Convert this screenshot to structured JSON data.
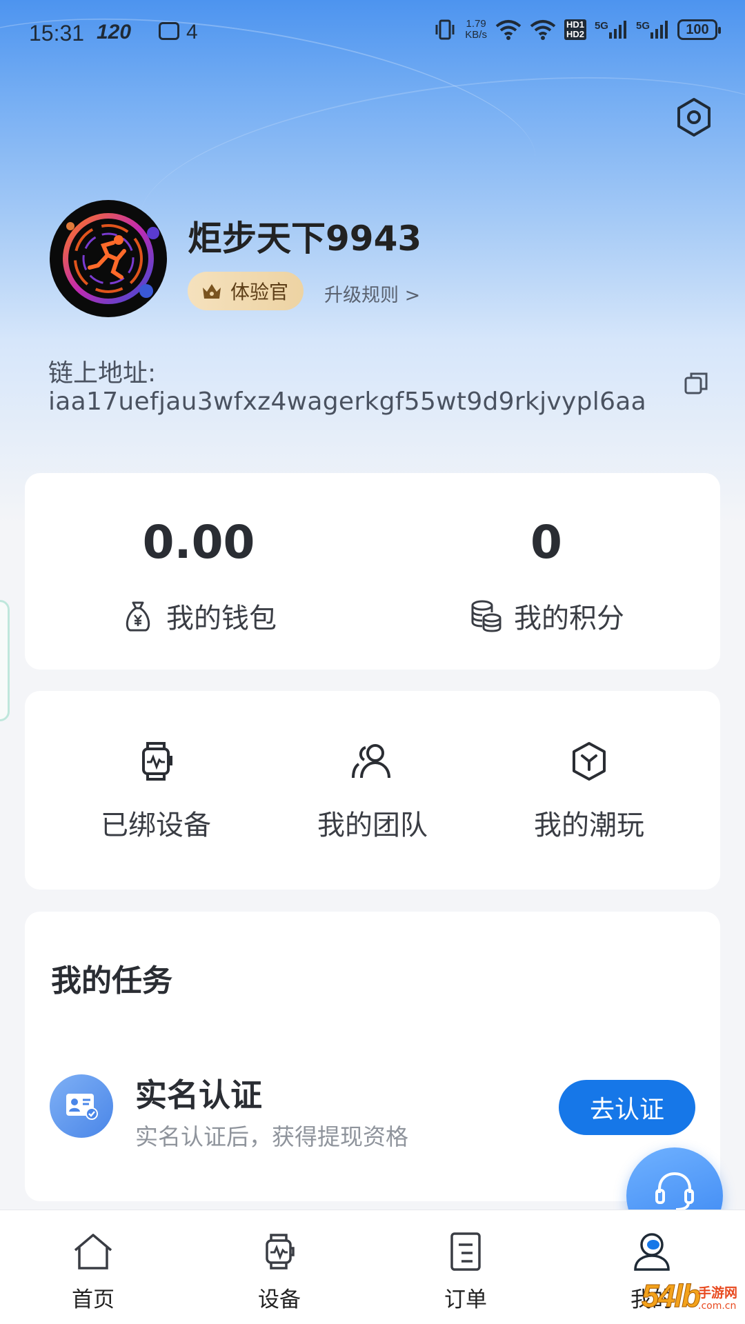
{
  "status_bar": {
    "time": "15:31",
    "refresh_rate": "120",
    "notification_count": "4",
    "net_speed_value": "1.79",
    "net_speed_unit": "KB/s",
    "hd1": "HD1",
    "hd2": "HD2",
    "sim1_network": "5G",
    "sim2_network": "5G",
    "battery": "100"
  },
  "profile": {
    "username": "炬步天下9943",
    "level": "体验官",
    "upgrade_rules": "升级规则 >",
    "chain_label": "链上地址:",
    "chain_address": "iaa17uefjau3wfxz4wagerkgf55wt9d9rkjvypl6aa"
  },
  "wallet": {
    "balance": "0.00",
    "balance_label": "我的钱包",
    "points": "0",
    "points_label": "我的积分"
  },
  "menu": {
    "items": [
      {
        "label": "已绑设备",
        "icon": "smartwatch-icon"
      },
      {
        "label": "我的团队",
        "icon": "team-icon"
      },
      {
        "label": "我的潮玩",
        "icon": "cube-icon"
      }
    ]
  },
  "tasks": {
    "title": "我的任务",
    "items": [
      {
        "title": "实名认证",
        "description": "实名认证后，获得提现资格",
        "action": "去认证",
        "icon": "id-card-icon"
      }
    ]
  },
  "tab_bar": {
    "items": [
      {
        "label": "首页",
        "icon": "home-icon"
      },
      {
        "label": "设备",
        "icon": "device-icon"
      },
      {
        "label": "订单",
        "icon": "order-icon"
      },
      {
        "label": "我的",
        "icon": "profile-icon"
      }
    ],
    "active_index": 3
  },
  "watermark": {
    "number": "54lb",
    "text": "手游网",
    "sub": ".com.cn"
  },
  "colors": {
    "accent": "#1677e8",
    "hero_top": "#4d94ef",
    "level_badge": "#f0d8ab",
    "page_bg": "#f4f5f8"
  }
}
